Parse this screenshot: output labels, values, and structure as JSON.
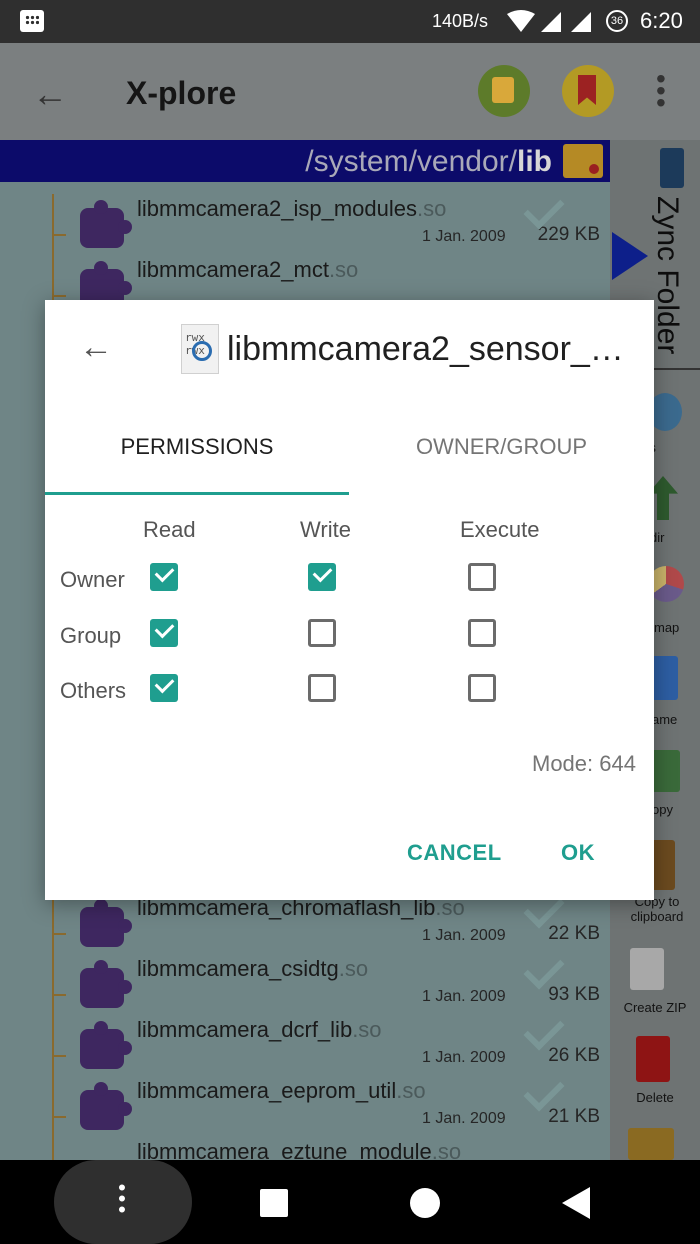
{
  "status": {
    "netspeed": "140B/s",
    "battery_level": "36",
    "time": "6:20"
  },
  "appbar": {
    "title": "X-plore"
  },
  "pathbar": {
    "path_prefix": "/system/vendor/",
    "path_bold": "lib"
  },
  "files": [
    {
      "name": "libmmcamera2_isp_modules",
      "ext": ".so",
      "date": "1 Jan. 2009",
      "size": "229 KB"
    },
    {
      "name": "libmmcamera2_mct",
      "ext": ".so",
      "date": "",
      "size": ""
    },
    {
      "name": "libmmcamera_chromaflash_lib",
      "ext": ".so",
      "date": "1 Jan. 2009",
      "size": "22 KB"
    },
    {
      "name": "libmmcamera_csidtg",
      "ext": ".so",
      "date": "1 Jan. 2009",
      "size": "93 KB"
    },
    {
      "name": "libmmcamera_dcrf_lib",
      "ext": ".so",
      "date": "1 Jan. 2009",
      "size": "26 KB"
    },
    {
      "name": "libmmcamera_eeprom_util",
      "ext": ".so",
      "date": "1 Jan. 2009",
      "size": "21 KB"
    },
    {
      "name": "libmmcamera_eztune_module",
      "ext": ".so",
      "date": "",
      "size": ""
    }
  ],
  "sidepanel": {
    "zync_label": "Zync Folder",
    "items": [
      "ws",
      "dir",
      "map",
      "ame",
      "opy",
      "Copy to clipboard",
      "Create ZIP",
      "Delete"
    ]
  },
  "dialog": {
    "title": "libmmcamera2_sensor_…",
    "tabs": [
      "PERMISSIONS",
      "OWNER/GROUP"
    ],
    "columns": [
      "Read",
      "Write",
      "Execute"
    ],
    "rows": [
      {
        "label": "Owner",
        "read": true,
        "write": true,
        "execute": false
      },
      {
        "label": "Group",
        "read": true,
        "write": false,
        "execute": false
      },
      {
        "label": "Others",
        "read": true,
        "write": false,
        "execute": false
      }
    ],
    "mode_label": "Mode:",
    "mode_value": "644",
    "cancel_label": "CANCEL",
    "ok_label": "OK"
  },
  "colors": {
    "accent": "#1f9e8f",
    "pathbar_bg": "#0c0b6a"
  }
}
